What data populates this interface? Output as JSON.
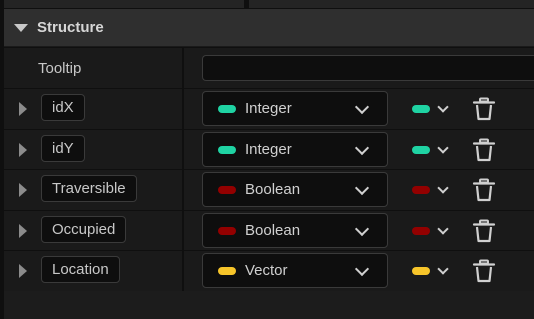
{
  "section": {
    "title": "Structure"
  },
  "tooltip": {
    "label": "Tooltip",
    "value": ""
  },
  "colors": {
    "integer": "#1fd3a3",
    "boolean": "#930000",
    "vector": "#f7c52a"
  },
  "icons": {
    "expand": "triangle-right",
    "collapse": "triangle-down",
    "dropdown": "chevron-down",
    "delete": "trash-can"
  },
  "variables": [
    {
      "name": "idX",
      "type": "Integer",
      "color": "#1fd3a3"
    },
    {
      "name": "idY",
      "type": "Integer",
      "color": "#1fd3a3"
    },
    {
      "name": "Traversible",
      "type": "Boolean",
      "color": "#930000"
    },
    {
      "name": "Occupied",
      "type": "Boolean",
      "color": "#930000"
    },
    {
      "name": "Location",
      "type": "Vector",
      "color": "#f7c52a"
    }
  ]
}
